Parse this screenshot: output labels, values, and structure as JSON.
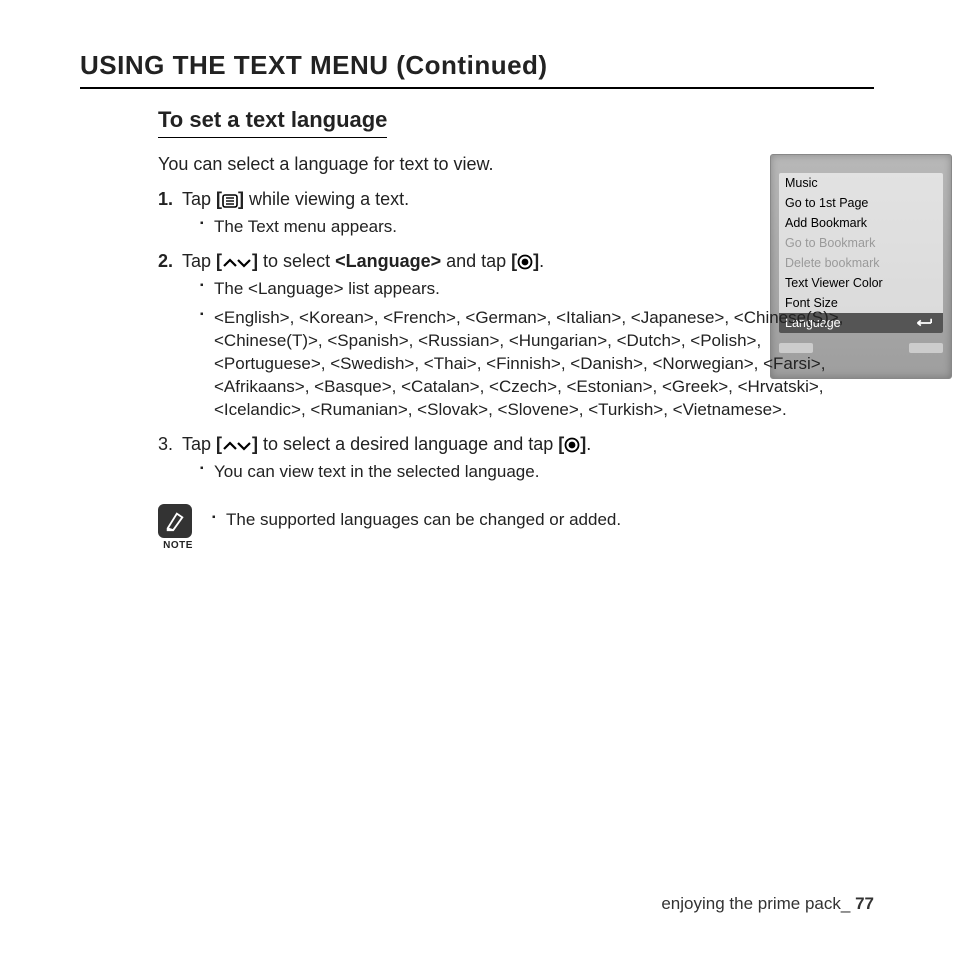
{
  "page_title": "USING THE TEXT MENU (Continued)",
  "section_title": "To set a text language",
  "intro": "You can select a language for text to view.",
  "steps": {
    "s1": {
      "num": "1.",
      "pre": "Tap ",
      "post": " while viewing a text.",
      "sub1": "The Text menu appears."
    },
    "s2": {
      "num": "2.",
      "pre": "Tap ",
      "mid": " to select ",
      "target": "<Language>",
      "mid2": " and tap ",
      "post": ".",
      "sub1": "The <Language> list appears.",
      "sub2": "<English>, <Korean>, <French>, <German>, <Italian>, <Japanese>, <Chinese(S)>, <Chinese(T)>, <Spanish>, <Russian>, <Hungarian>, <Dutch>, <Polish>, <Portuguese>, <Swedish>, <Thai>, <Finnish>, <Danish>, <Norwegian>, <Farsi>, <Afrikaans>, <Basque>, <Catalan>, <Czech>, <Estonian>, <Greek>, <Hrvatski>, <Icelandic>, <Rumanian>, <Slovak>, <Slovene>, <Turkish>, <Vietnamese>."
    },
    "s3": {
      "num": "3.",
      "pre": "Tap ",
      "mid": " to select a desired language and tap ",
      "post": ".",
      "sub1": "You can view text in the selected language."
    }
  },
  "brackets": {
    "open": "[",
    "close": "]"
  },
  "note": {
    "label": "NOTE",
    "text": "The supported languages can be changed or added."
  },
  "device_menu": {
    "items": [
      {
        "label": "Music",
        "dim": false
      },
      {
        "label": "Go to 1st Page",
        "dim": false
      },
      {
        "label": "Add Bookmark",
        "dim": false
      },
      {
        "label": "Go to Bookmark",
        "dim": true
      },
      {
        "label": "Delete bookmark",
        "dim": true
      },
      {
        "label": "Text Viewer Color",
        "dim": false
      },
      {
        "label": "Font Size",
        "dim": false
      }
    ],
    "selected": "Language"
  },
  "footer": {
    "text": "enjoying the prime pack_ ",
    "page": "77"
  }
}
